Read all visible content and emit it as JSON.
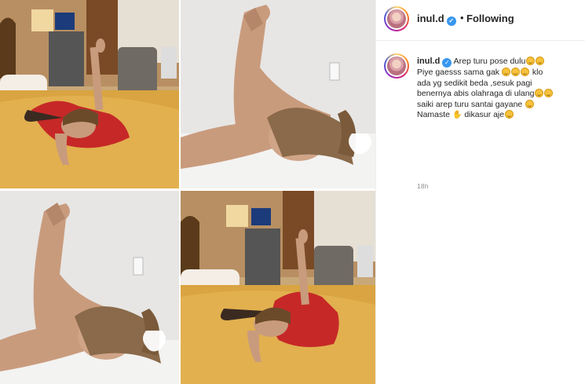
{
  "post": {
    "media": {
      "tiles": [
        {
          "name": "photo-bedroom-wide-1"
        },
        {
          "name": "photo-closeup-stretch-1"
        },
        {
          "name": "photo-closeup-stretch-2"
        },
        {
          "name": "photo-bedroom-wide-2"
        }
      ],
      "colors": {
        "bedspread": "#d9a441",
        "wall": "#c9a878",
        "shirt": "#c62828",
        "skin": "#c99b7d",
        "floor_cover": "#ecebe9"
      }
    },
    "header": {
      "username": "inul.d",
      "separator": "•",
      "follow_label": "Following",
      "verified_icon": "verified-badge-icon"
    },
    "caption": {
      "username": "inul.d",
      "lines": [
        "Arep turu pose dulu",
        "Piye gaesss sama gak",
        "klo",
        "ada yg sedikit beda ,sesuk pagi",
        "benernya abis olahraga di ulang",
        "saiki arep turu santai gayane",
        "Namaste",
        "dikasur aje"
      ],
      "timestamp": "18h"
    },
    "colors": {
      "accent_blue": "#3897f0",
      "text": "#262626",
      "muted": "#8e8e8e",
      "border": "#efefef"
    }
  }
}
